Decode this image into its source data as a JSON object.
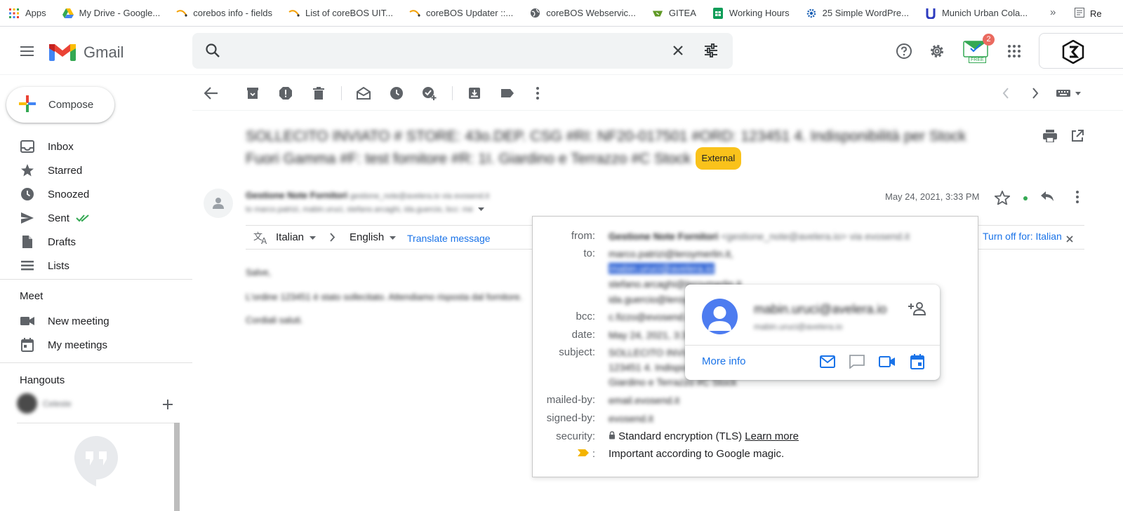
{
  "bookmarks": {
    "items": [
      {
        "label": "Apps",
        "icon": "apps-grid-icon"
      },
      {
        "label": "My Drive - Google...",
        "icon": "google-drive-icon"
      },
      {
        "label": "corebos info - fields",
        "icon": "corebos-icon"
      },
      {
        "label": "List of coreBOS UIT...",
        "icon": "corebos-icon"
      },
      {
        "label": "coreBOS Updater ::...",
        "icon": "corebos-icon"
      },
      {
        "label": "coreBOS Webservic...",
        "icon": "globe-icon"
      },
      {
        "label": "GITEA",
        "icon": "gitea-icon"
      },
      {
        "label": "Working Hours",
        "icon": "sheets-icon"
      },
      {
        "label": "25 Simple WordPre...",
        "icon": "gear-icon"
      },
      {
        "label": "Munich Urban Cola...",
        "icon": "bookmark-u-icon"
      }
    ],
    "more": "»",
    "reading_list": "Re"
  },
  "header": {
    "app_name": "Gmail",
    "notification_count": "2",
    "addon_badge": "FREE"
  },
  "sidebar": {
    "compose_label": "Compose",
    "items": [
      {
        "label": "Inbox",
        "icon": "inbox-icon"
      },
      {
        "label": "Starred",
        "icon": "star-icon"
      },
      {
        "label": "Snoozed",
        "icon": "clock-icon"
      },
      {
        "label": "Sent",
        "icon": "send-icon"
      },
      {
        "label": "Drafts",
        "icon": "draft-icon"
      },
      {
        "label": "Lists",
        "icon": "list-icon"
      }
    ],
    "meet": {
      "title": "Meet",
      "new_meeting": "New meeting",
      "my_meetings": "My meetings"
    },
    "hangouts": {
      "title": "Hangouts",
      "user": "Celeste"
    }
  },
  "message": {
    "subject_line1": "SOLLECITO INVIATO # STORE: 43o.DEP. CSG #RI: NF20-017501 #ORD: 123451 4. Indisponibilità per Stock",
    "subject_line2": "Fuori Gamma #F: test fornitore #R: 1I. Giardino e Terrazzo #C Stock",
    "external_badge": "External",
    "sender_name": "Gestione Note Fornitori",
    "sender_email": "gestione_note@avelera.io via evosend.it",
    "recipients": "to marco.patrizi, mabin.uruci, stefano.arcaghi, ida.guercio, bcc: me",
    "date": "May 24, 2021, 3:33 PM",
    "translate": {
      "from_lang": "Italian",
      "to_lang": "English",
      "translate_label": "Translate message",
      "turn_off": "Turn off for: Italian"
    },
    "body": [
      "Salve,",
      "L'ordine 123451 è stato sollecitato. Attendiamo risposta dal fornitore.",
      "Cordiali saluti."
    ]
  },
  "details": {
    "from_label": "from:",
    "from_value": "Gestione Note Fornitori",
    "from_email": "<gestione_note@avelera.io> via evosend.it",
    "to_label": "to:",
    "to_values": [
      "marco.patrizi@leroymerlin.it,",
      "mabin.uruci@avelera.io",
      "stefano.arcaghi@leroymerlin.it",
      "ida.guercio@leroymerlin.it"
    ],
    "bcc_label": "bcc:",
    "bcc_value": "c.fizzo@evosend.it",
    "date_label": "date:",
    "date_value": "May 24, 2021, 3:33 PM",
    "subject_label": "subject:",
    "subject_values": [
      "SOLLECITO INVIATO # STORE",
      "123451 4. Indisponibilità",
      "Giardino e Terrazzo #C Stock"
    ],
    "mailed_by_label": "mailed-by:",
    "mailed_by_value": "email.evosend.it",
    "signed_by_label": "signed-by:",
    "signed_by_value": "evosend.it",
    "security_label": "security:",
    "security_value": "Standard encryption (TLS)",
    "learn_more": "Learn more",
    "importance_label": ":",
    "importance_value": "Important according to Google magic."
  },
  "contact_card": {
    "name": "mabin.uruci@avelera.io",
    "email": "mabin.uruci@avelera.io",
    "more_info": "More info"
  },
  "colors": {
    "gmail_blue": "#1a73e8",
    "external_badge": "#f9c21b",
    "selection": "#3367d6",
    "importance": "#f4b400"
  }
}
